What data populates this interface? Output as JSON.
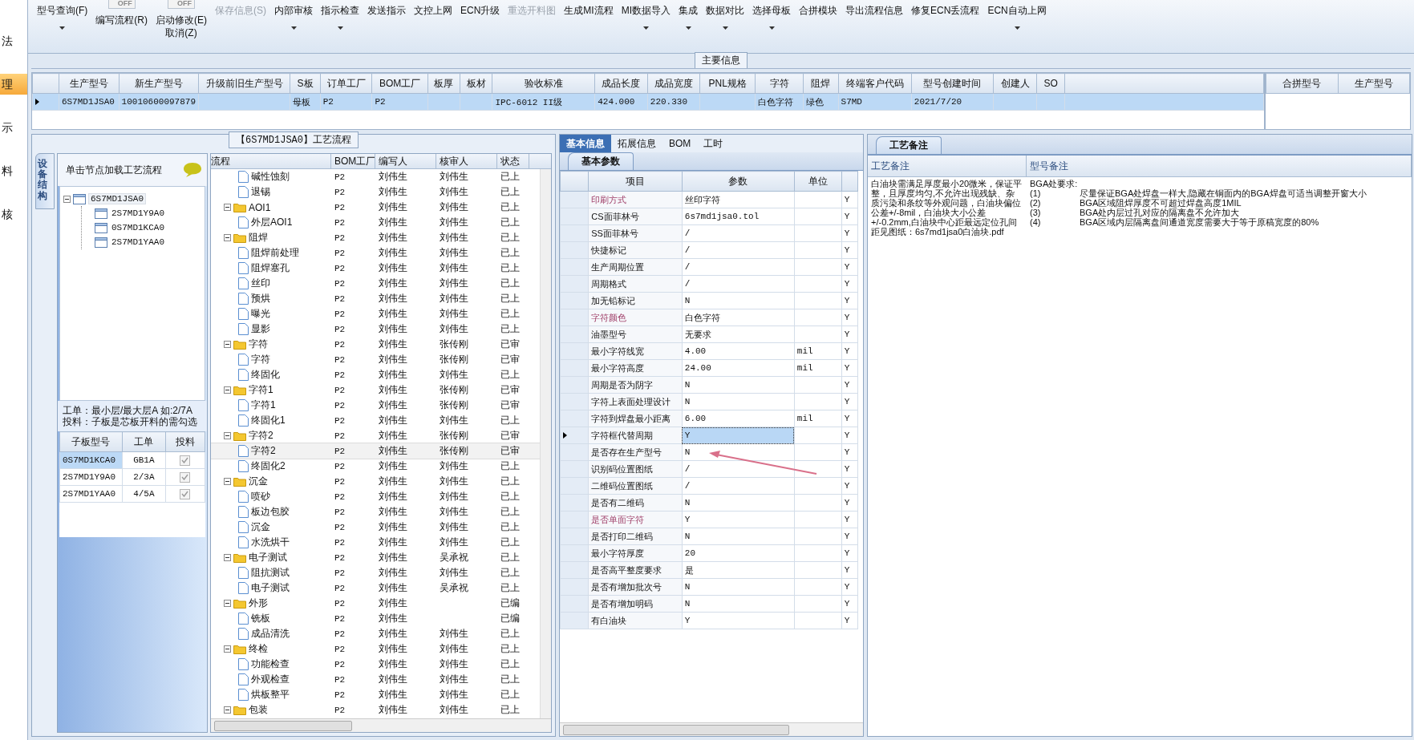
{
  "nav": [
    {
      "label": "法",
      "selected": false
    },
    {
      "label": "理",
      "selected": true
    },
    {
      "label": "示",
      "selected": false
    },
    {
      "label": "料",
      "selected": false
    },
    {
      "label": "核",
      "selected": false
    }
  ],
  "toolbar": [
    {
      "label": "型号查询(F)",
      "caret": true,
      "disabled": false
    },
    {
      "label": "编写流程(R)",
      "toggle": {
        "label": "OFF",
        "on": false
      },
      "caret": false,
      "disabled": false
    },
    {
      "label": "启动修改(E)",
      "label2": "取消(Z)",
      "toggle": {
        "label": "OFF",
        "on": false
      },
      "caret": false,
      "disabled": false
    },
    {
      "label": "保存信息(S)",
      "caret": false,
      "disabled": true
    },
    {
      "label": "内部审核",
      "caret": true,
      "disabled": false
    },
    {
      "label": "指示检查",
      "caret": true,
      "disabled": false
    },
    {
      "label": "发送指示",
      "caret": false,
      "disabled": false
    },
    {
      "label": "文控上网",
      "caret": false,
      "disabled": false
    },
    {
      "label": "ECN升级",
      "caret": false,
      "disabled": false
    },
    {
      "label": "重选开料图",
      "caret": false,
      "disabled": true
    },
    {
      "label": "生成MI流程",
      "caret": false,
      "disabled": false
    },
    {
      "label": "MI数据导入",
      "caret": true,
      "disabled": false
    },
    {
      "label": "集成",
      "caret": true,
      "disabled": false
    },
    {
      "label": "数据对比",
      "caret": true,
      "disabled": false
    },
    {
      "label": "选择母板",
      "caret": true,
      "disabled": false
    },
    {
      "label": "合拼模块",
      "caret": false,
      "disabled": false
    },
    {
      "label": "导出流程信息",
      "caret": false,
      "disabled": false
    },
    {
      "label": "修复ECN丢流程",
      "caret": false,
      "disabled": false
    },
    {
      "label": "ECN自动上网",
      "caret": true,
      "disabled": false
    }
  ],
  "main_info": {
    "title": "主要信息",
    "columns": [
      "生产型号",
      "新生产型号",
      "升级前旧生产型号",
      "S板",
      "订单工厂",
      "BOM工厂",
      "板厚",
      "板材",
      "验收标准",
      "成品长度",
      "成品宽度",
      "PNL规格",
      "字符",
      "阻焊",
      "终端客户代码",
      "型号创建时间",
      "创建人",
      "SO"
    ],
    "rows": [
      {
        "selected": true,
        "cells": [
          "6S7MD1JSA0",
          "10010600097879",
          null,
          "母板",
          "P2",
          "P2",
          null,
          null,
          "IPC-6012 II级",
          "424.000",
          "220.330",
          null,
          "白色字符",
          "绿色",
          "S7MD",
          "2021/7/20",
          null,
          null
        ]
      }
    ]
  },
  "merge_table": {
    "columns": [
      "合拼型号",
      "生产型号"
    ]
  },
  "process_panel": {
    "title": "【6S7MD1JSA0】工艺流程",
    "side_tab": "设备结构",
    "hint": "单击节点加载工艺流程",
    "tree": [
      {
        "label": "6S7MD1JSA0",
        "selected": true,
        "expanded": true,
        "children": [
          {
            "label": "2S7MD1Y9A0",
            "selected": false
          },
          {
            "label": "0S7MD1KCA0",
            "selected": false
          },
          {
            "label": "2S7MD1YAA0",
            "selected": false
          }
        ]
      }
    ],
    "notes": [
      "工单：最小层/最大层A 如:2/7A",
      "投料：子板是芯板开料的需勾选"
    ],
    "sub_table": {
      "columns": [
        "子板型号",
        "工单",
        "投料"
      ],
      "rows": [
        {
          "cells": [
            "0S7MD1KCA0",
            "GB1A"
          ],
          "checked": true,
          "selected": true
        },
        {
          "cells": [
            "2S7MD1Y9A0",
            "2/3A"
          ],
          "checked": true,
          "selected": false
        },
        {
          "cells": [
            "2S7MD1YAA0",
            "4/5A"
          ],
          "checked": true,
          "selected": false
        }
      ]
    }
  },
  "process_grid": {
    "columns": [
      "流程",
      "BOM工厂",
      "编写人",
      "核审人",
      "状态"
    ],
    "rows": [
      {
        "kind": "step",
        "label": "碱性蚀刻",
        "bom": "P2",
        "writer": "刘伟生",
        "reviewer": "刘伟生",
        "status": "已上",
        "selected": false
      },
      {
        "kind": "step",
        "label": "退锡",
        "bom": "P2",
        "writer": "刘伟生",
        "reviewer": "刘伟生",
        "status": "已上",
        "selected": false
      },
      {
        "kind": "folder",
        "label": "AOI1",
        "bom": "P2",
        "writer": "刘伟生",
        "reviewer": "刘伟生",
        "status": "已上",
        "selected": false,
        "expanded": true,
        "children": [
          {
            "kind": "step",
            "label": "外层AOI1",
            "bom": "P2",
            "writer": "刘伟生",
            "reviewer": "刘伟生",
            "status": "已上",
            "selected": false
          }
        ]
      },
      {
        "kind": "folder",
        "label": "阻焊",
        "bom": "P2",
        "writer": "刘伟生",
        "reviewer": "刘伟生",
        "status": "已上",
        "selected": false,
        "expanded": true,
        "children": [
          {
            "kind": "step",
            "label": "阻焊前处理",
            "bom": "P2",
            "writer": "刘伟生",
            "reviewer": "刘伟生",
            "status": "已上",
            "selected": false
          },
          {
            "kind": "step",
            "label": "阻焊塞孔",
            "bom": "P2",
            "writer": "刘伟生",
            "reviewer": "刘伟生",
            "status": "已上",
            "selected": false
          },
          {
            "kind": "step",
            "label": "丝印",
            "bom": "P2",
            "writer": "刘伟生",
            "reviewer": "刘伟生",
            "status": "已上",
            "selected": false
          },
          {
            "kind": "step",
            "label": "预烘",
            "bom": "P2",
            "writer": "刘伟生",
            "reviewer": "刘伟生",
            "status": "已上",
            "selected": false
          },
          {
            "kind": "step",
            "label": "曝光",
            "bom": "P2",
            "writer": "刘伟生",
            "reviewer": "刘伟生",
            "status": "已上",
            "selected": false
          },
          {
            "kind": "step",
            "label": "显影",
            "bom": "P2",
            "writer": "刘伟生",
            "reviewer": "刘伟生",
            "status": "已上",
            "selected": false
          }
        ]
      },
      {
        "kind": "folder",
        "label": "字符",
        "bom": "P2",
        "writer": "刘伟生",
        "reviewer": "张传刚",
        "status": "已审",
        "selected": false,
        "expanded": true,
        "children": [
          {
            "kind": "step",
            "label": "字符",
            "bom": "P2",
            "writer": "刘伟生",
            "reviewer": "张传刚",
            "status": "已审",
            "selected": false
          },
          {
            "kind": "step",
            "label": "终固化",
            "bom": "P2",
            "writer": "刘伟生",
            "reviewer": "刘伟生",
            "status": "已上",
            "selected": false
          }
        ]
      },
      {
        "kind": "folder",
        "label": "字符1",
        "bom": "P2",
        "writer": "刘伟生",
        "reviewer": "张传刚",
        "status": "已审",
        "selected": false,
        "expanded": true,
        "children": [
          {
            "kind": "step",
            "label": "字符1",
            "bom": "P2",
            "writer": "刘伟生",
            "reviewer": "张传刚",
            "status": "已审",
            "selected": false
          },
          {
            "kind": "step",
            "label": "终固化1",
            "bom": "P2",
            "writer": "刘伟生",
            "reviewer": "刘伟生",
            "status": "已上",
            "selected": false
          }
        ]
      },
      {
        "kind": "folder",
        "label": "字符2",
        "bom": "P2",
        "writer": "刘伟生",
        "reviewer": "张传刚",
        "status": "已审",
        "selected": false,
        "expanded": true,
        "children": [
          {
            "kind": "step",
            "label": "字符2",
            "bom": "P2",
            "writer": "刘伟生",
            "reviewer": "张传刚",
            "status": "已审",
            "selected": true
          },
          {
            "kind": "step",
            "label": "终固化2",
            "bom": "P2",
            "writer": "刘伟生",
            "reviewer": "刘伟生",
            "status": "已上",
            "selected": false
          }
        ]
      },
      {
        "kind": "folder",
        "label": "沉金",
        "bom": "P2",
        "writer": "刘伟生",
        "reviewer": "刘伟生",
        "status": "已上",
        "selected": false,
        "expanded": true,
        "children": [
          {
            "kind": "step",
            "label": "喷砂",
            "bom": "P2",
            "writer": "刘伟生",
            "reviewer": "刘伟生",
            "status": "已上",
            "selected": false
          },
          {
            "kind": "step",
            "label": "板边包胶",
            "bom": "P2",
            "writer": "刘伟生",
            "reviewer": "刘伟生",
            "status": "已上",
            "selected": false
          },
          {
            "kind": "step",
            "label": "沉金",
            "bom": "P2",
            "writer": "刘伟生",
            "reviewer": "刘伟生",
            "status": "已上",
            "selected": false
          },
          {
            "kind": "step",
            "label": "水洗烘干",
            "bom": "P2",
            "writer": "刘伟生",
            "reviewer": "刘伟生",
            "status": "已上",
            "selected": false
          }
        ]
      },
      {
        "kind": "folder",
        "label": "电子测试",
        "bom": "P2",
        "writer": "刘伟生",
        "reviewer": "吴承祝",
        "status": "已上",
        "selected": false,
        "expanded": true,
        "children": [
          {
            "kind": "step",
            "label": "阻抗测试",
            "bom": "P2",
            "writer": "刘伟生",
            "reviewer": "刘伟生",
            "status": "已上",
            "selected": false
          },
          {
            "kind": "step",
            "label": "电子测试",
            "bom": "P2",
            "writer": "刘伟生",
            "reviewer": "吴承祝",
            "status": "已上",
            "selected": false
          }
        ]
      },
      {
        "kind": "folder",
        "label": "外形",
        "bom": "P2",
        "writer": "刘伟生",
        "status": "已编",
        "selected": false,
        "expanded": true,
        "children": [
          {
            "kind": "step",
            "label": "铣板",
            "bom": "P2",
            "writer": "刘伟生",
            "status": "已编",
            "selected": false
          },
          {
            "kind": "step",
            "label": "成品清洗",
            "bom": "P2",
            "writer": "刘伟生",
            "reviewer": "刘伟生",
            "status": "已上",
            "selected": false
          }
        ]
      },
      {
        "kind": "folder",
        "label": "终检",
        "bom": "P2",
        "writer": "刘伟生",
        "reviewer": "刘伟生",
        "status": "已上",
        "selected": false,
        "expanded": true,
        "children": [
          {
            "kind": "step",
            "label": "功能检查",
            "bom": "P2",
            "writer": "刘伟生",
            "reviewer": "刘伟生",
            "status": "已上",
            "selected": false
          },
          {
            "kind": "step",
            "label": "外观检查",
            "bom": "P2",
            "writer": "刘伟生",
            "reviewer": "刘伟生",
            "status": "已上",
            "selected": false
          },
          {
            "kind": "step",
            "label": "烘板整平",
            "bom": "P2",
            "writer": "刘伟生",
            "reviewer": "刘伟生",
            "status": "已上",
            "selected": false
          }
        ]
      },
      {
        "kind": "folder",
        "label": "包装",
        "bom": "P2",
        "writer": "刘伟生",
        "reviewer": "刘伟生",
        "status": "已上",
        "selected": false,
        "expanded": true
      }
    ]
  },
  "params_panel": {
    "tabs": [
      {
        "label": "基本信息",
        "selected": true
      },
      {
        "label": "拓展信息",
        "selected": false
      },
      {
        "label": "BOM",
        "selected": false
      },
      {
        "label": "工时",
        "selected": false
      }
    ],
    "subtab": "基本参数",
    "columns": [
      "项目",
      "参数",
      "单位"
    ],
    "rows": [
      {
        "item": "印刷方式",
        "value": "丝印字符",
        "flag": "Y",
        "highlighted": true,
        "selected": false
      },
      {
        "item": "CS面菲林号",
        "value": "6s7md1jsa0.tol",
        "flag": "Y",
        "highlighted": false,
        "selected": false
      },
      {
        "item": "SS面菲林号",
        "value": "/",
        "flag": "Y",
        "highlighted": false,
        "selected": false
      },
      {
        "item": "快捷标记",
        "value": "/",
        "flag": "Y",
        "highlighted": false,
        "selected": false
      },
      {
        "item": "生产周期位置",
        "value": "/",
        "flag": "Y",
        "highlighted": false,
        "selected": false
      },
      {
        "item": "周期格式",
        "value": "/",
        "flag": "Y",
        "highlighted": false,
        "selected": false
      },
      {
        "item": "加无铅标记",
        "value": "N",
        "flag": "Y",
        "highlighted": false,
        "selected": false
      },
      {
        "item": "字符颜色",
        "value": "白色字符",
        "flag": "Y",
        "highlighted": true,
        "selected": false
      },
      {
        "item": "油墨型号",
        "value": "无要求",
        "flag": "Y",
        "highlighted": false,
        "selected": false
      },
      {
        "item": "最小字符线宽",
        "value": "4.00",
        "unit": "mil",
        "flag": "Y",
        "highlighted": false,
        "selected": false
      },
      {
        "item": "最小字符高度",
        "value": "24.00",
        "unit": "mil",
        "flag": "Y",
        "highlighted": false,
        "selected": false
      },
      {
        "item": "周期是否为阴字",
        "value": "N",
        "flag": "Y",
        "highlighted": false,
        "selected": false
      },
      {
        "item": "字符上表面处理设计",
        "value": "N",
        "flag": "Y",
        "highlighted": false,
        "selected": false
      },
      {
        "item": "字符到焊盘最小距离",
        "value": "6.00",
        "unit": "mil",
        "flag": "Y",
        "highlighted": false,
        "selected": false
      },
      {
        "item": "字符框代替周期",
        "value": "Y",
        "flag": "Y",
        "highlighted": false,
        "selected": true
      },
      {
        "item": "是否存在生产型号",
        "value": "N",
        "flag": "Y",
        "highlighted": false,
        "selected": false
      },
      {
        "item": "识别码位置图纸",
        "value": "/",
        "flag": "Y",
        "highlighted": false,
        "selected": false
      },
      {
        "item": "二维码位置图纸",
        "value": "/",
        "flag": "Y",
        "highlighted": false,
        "selected": false
      },
      {
        "item": "是否有二维码",
        "value": "N",
        "flag": "Y",
        "highlighted": false,
        "selected": false
      },
      {
        "item": "是否单面字符",
        "value": "Y",
        "flag": "Y",
        "highlighted": true,
        "selected": false
      },
      {
        "item": "是否打印二维码",
        "value": "N",
        "flag": "Y",
        "highlighted": false,
        "selected": false
      },
      {
        "item": "最小字符厚度",
        "value": "20",
        "flag": "Y",
        "highlighted": false,
        "selected": false
      },
      {
        "item": "是否高平整度要求",
        "value": "是",
        "flag": "Y",
        "highlighted": false,
        "selected": false
      },
      {
        "item": "是否有增加批次号",
        "value": "N",
        "flag": "Y",
        "highlighted": false,
        "selected": false
      },
      {
        "item": "是否有增加明码",
        "value": "N",
        "flag": "Y",
        "highlighted": false,
        "selected": false
      },
      {
        "item": "有白油块",
        "value": "Y",
        "flag": "Y",
        "highlighted": false,
        "selected": false
      }
    ]
  },
  "notes_panel": {
    "tab": "工艺备注",
    "columns": [
      "工艺备注",
      "型号备注"
    ],
    "process_note": "白油块需满足厚度最小20微米，保证平整，且厚度均匀,不允许出现残缺、杂质污染和条纹等外观问题，白油块偏位公差+/-8mil，白油块大小公差+/-0.2mm,白油块中心距最远定位孔间距见图纸：6s7md1jsa0白油块.pdf",
    "model_note": {
      "title": "BGA处要求:",
      "items": [
        {
          "num": "(1)",
          "text": "尽量保证BGA处焊盘一样大,隐藏在铜面内的BGA焊盘可适当调整开窗大小"
        },
        {
          "num": "(2)",
          "text": "BGA区域阻焊厚度不可超过焊盘高度1MIL"
        },
        {
          "num": "(3)",
          "text": "BGA处内层过孔对应的隔离盘不允许加大"
        },
        {
          "num": "(4)",
          "text": "BGA区域内层隔离盘间通道宽度需要大于等于原稿宽度的80%"
        }
      ]
    }
  }
}
